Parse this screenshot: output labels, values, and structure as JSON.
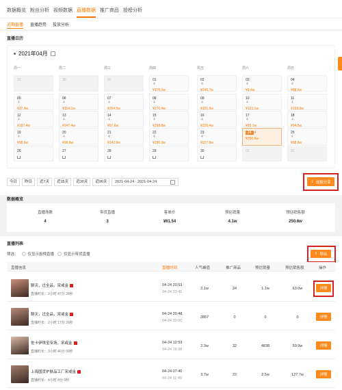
{
  "topnav": {
    "tabs": [
      "数据概览",
      "粉丝分析",
      "视频数据",
      "直播数据",
      "推广商品",
      "投榜分析"
    ],
    "active": 3
  },
  "subnav": {
    "tabs": [
      "近期直播",
      "直播趋势",
      "投放分析"
    ],
    "active": 0
  },
  "calendar": {
    "section_title": "直播日历",
    "month_label": "2021年04月",
    "weekdays": [
      "周一",
      "周二",
      "周三",
      "周四",
      "周五",
      "周六",
      "周日"
    ],
    "weeks": [
      [
        {
          "day": "29",
          "state": "empty"
        },
        {
          "day": "30",
          "state": "empty"
        },
        {
          "day": "31",
          "state": "empty"
        },
        {
          "day": "01",
          "count": "4",
          "value": "¥178.2w"
        },
        {
          "day": "02",
          "count": "4",
          "value": "¥240.7w"
        },
        {
          "day": "03",
          "count": "4",
          "value": "¥8.4w"
        },
        {
          "day": "04",
          "count": "4",
          "value": "¥88.6w"
        }
      ],
      [
        {
          "day": "05",
          "count": "4",
          "value": "¥37.4w"
        },
        {
          "day": "06",
          "count": "4",
          "value": "¥154.1w"
        },
        {
          "day": "07",
          "count": "4",
          "value": "¥264.5w"
        },
        {
          "day": "08",
          "count": "4",
          "value": "¥276.4w"
        },
        {
          "day": "09",
          "count": "4",
          "value": "¥201.9w"
        },
        {
          "day": "10",
          "count": "4",
          "value": "¥123.1w"
        },
        {
          "day": "11",
          "count": "4",
          "value": "¥158.9w"
        }
      ],
      [
        {
          "day": "12",
          "count": "4",
          "value": "¥187.4w"
        },
        {
          "day": "13",
          "count": "4",
          "value": "¥147.4w"
        },
        {
          "day": "14",
          "count": "4",
          "value": "¥57.6w"
        },
        {
          "day": "15",
          "count": "4",
          "value": "¥298.8w"
        },
        {
          "day": "16",
          "count": "4",
          "value": "¥226.4w"
        },
        {
          "day": "17",
          "count": "4",
          "value": "¥95.1w"
        },
        {
          "day": "18",
          "count": "4",
          "value": "¥94.5w"
        }
      ],
      [
        {
          "day": "19",
          "count": "4",
          "value": "¥98.6w"
        },
        {
          "day": "20",
          "count": "4",
          "value": "¥98.8w"
        },
        {
          "day": "21",
          "count": "4",
          "value": "¥142.9w"
        },
        {
          "day": "22",
          "count": "4",
          "value": "¥286.3w"
        },
        {
          "day": "23",
          "count": "4",
          "value": "¥227.8w"
        },
        {
          "day": "24",
          "count": "4",
          "value": "¥250.6w",
          "state": "selected"
        },
        {
          "day": "25",
          "count": "4",
          "value": "¥98.8w"
        }
      ],
      [
        {
          "day": "26",
          "state": "cart"
        },
        {
          "day": "27",
          "state": "cart"
        },
        {
          "day": "28",
          "state": "cart"
        },
        {
          "day": "29",
          "state": "cart"
        },
        {
          "day": "30",
          "state": "cart"
        },
        {
          "day": "01",
          "state": "empty"
        },
        {
          "day": "02",
          "state": "empty"
        }
      ]
    ]
  },
  "date_filter": {
    "buttons": [
      "今日",
      "昨日",
      "近7天",
      "近15天",
      "近30天",
      "近90天"
    ],
    "range": "2021-04-24 - 2021-04-24"
  },
  "share_button": "战报分享",
  "overview": {
    "title": "数据概览",
    "stats": [
      {
        "label": "直播场数",
        "value": "4"
      },
      {
        "label": "带货直播",
        "value": "3"
      },
      {
        "label": "客单价",
        "value": "¥61.54"
      },
      {
        "label": "预估销量",
        "value": "4.1w"
      },
      {
        "label": "预估销售额",
        "value": "250.6w"
      }
    ]
  },
  "list": {
    "title": "直播列表",
    "filter_label": "筛选：",
    "filter_options": [
      "仅显示投榜直播",
      "仅显示带货直播"
    ],
    "export_button": "导出",
    "headers": [
      "直播信息",
      "直播时间",
      "人气峰值",
      "推广商品",
      "预估销量",
      "预估销售额",
      "操作"
    ],
    "detail_label": "详情",
    "rows": [
      {
        "title": "聊天，过全品，宋戒金",
        "duration": "直播时长：2小时 47分 28秒",
        "time_start": "04-24 20:53",
        "time_end": "04-24 23:41",
        "peak": "2.1w",
        "products": "24",
        "sales": "1.1w",
        "revenue": "63.0w"
      },
      {
        "title": "聊天，过全品，宋戒金",
        "duration": "直播时长：2小时 17分 26秒",
        "time_start": "04-24 20:48",
        "time_end": "04-24 20:50",
        "peak": "2857",
        "products": "0",
        "sales": "0",
        "revenue": "0"
      },
      {
        "title": "佐卡伊珠宝专场，宋戒金",
        "duration": "直播时长：3小时 46分 09秒",
        "time_start": "04-24 12:53",
        "time_end": "04-24 16:38",
        "peak": "2.3w",
        "products": "32",
        "sales": "4838",
        "revenue": "59.9w"
      },
      {
        "title": "上海国货护肤品工厂宋戒金",
        "duration": "直播时长：4小时 8分 0秒",
        "time_start": "04-24 07:40",
        "time_end": "04-24 11:49",
        "peak": "3.7w",
        "products": "22",
        "sales": "2.5w",
        "revenue": "127.7w"
      }
    ]
  }
}
